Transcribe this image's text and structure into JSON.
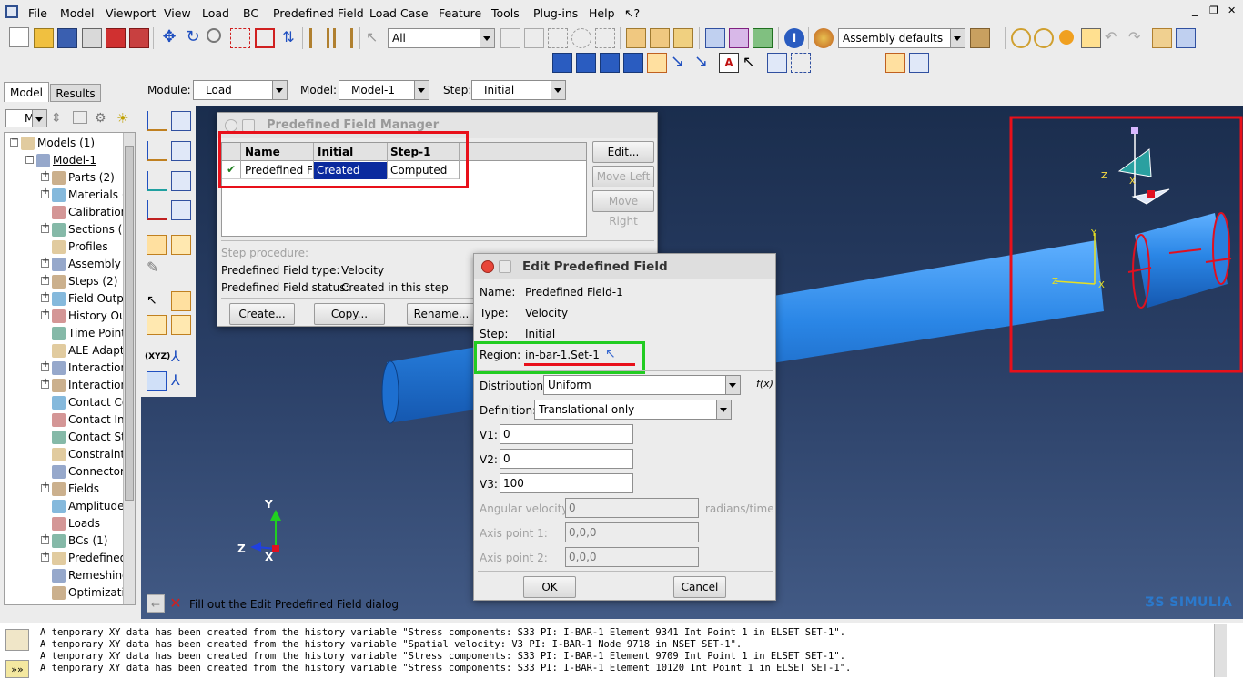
{
  "menu": [
    "File",
    "Model",
    "Viewport",
    "View",
    "Load",
    "BC",
    "Predefined Field",
    "Load Case",
    "Feature",
    "Tools",
    "Plug-ins",
    "Help"
  ],
  "toolbar": {
    "selection_filter": "All",
    "render_style": "Assembly defaults"
  },
  "left_tabs": [
    "Model",
    "Results"
  ],
  "context_bar": {
    "module_label": "Module:",
    "module_value": "Load",
    "model_label": "Model:",
    "model_value": "Model-1",
    "step_label": "Step:",
    "step_value": "Initial"
  },
  "tree": {
    "combo_value": "M",
    "nodes": [
      {
        "label": "Models (1)",
        "indent": 0,
        "expander": "-"
      },
      {
        "label": "Model-1",
        "indent": 1,
        "expander": "-"
      },
      {
        "label": "Parts (2)",
        "indent": 2,
        "expander": "+"
      },
      {
        "label": "Materials (",
        "indent": 2,
        "expander": "+"
      },
      {
        "label": "Calibration",
        "indent": 2,
        "expander": ""
      },
      {
        "label": "Sections (",
        "indent": 2,
        "expander": "+"
      },
      {
        "label": "Profiles",
        "indent": 2,
        "expander": ""
      },
      {
        "label": "Assembly",
        "indent": 2,
        "expander": "+"
      },
      {
        "label": "Steps (2)",
        "indent": 2,
        "expander": "+"
      },
      {
        "label": "Field Outp",
        "indent": 2,
        "expander": "+"
      },
      {
        "label": "History Ou",
        "indent": 2,
        "expander": "+"
      },
      {
        "label": "Time Point",
        "indent": 2,
        "expander": ""
      },
      {
        "label": "ALE Adapt",
        "indent": 2,
        "expander": ""
      },
      {
        "label": "Interaction",
        "indent": 2,
        "expander": "+"
      },
      {
        "label": "Interaction",
        "indent": 2,
        "expander": "+"
      },
      {
        "label": "Contact Co",
        "indent": 2,
        "expander": ""
      },
      {
        "label": "Contact Ini",
        "indent": 2,
        "expander": ""
      },
      {
        "label": "Contact St",
        "indent": 2,
        "expander": ""
      },
      {
        "label": "Constraint",
        "indent": 2,
        "expander": ""
      },
      {
        "label": "Connector",
        "indent": 2,
        "expander": ""
      },
      {
        "label": "Fields",
        "indent": 2,
        "expander": "+"
      },
      {
        "label": "Amplitudes",
        "indent": 2,
        "expander": ""
      },
      {
        "label": "Loads",
        "indent": 2,
        "expander": ""
      },
      {
        "label": "BCs (1)",
        "indent": 2,
        "expander": "+"
      },
      {
        "label": "Predefined",
        "indent": 2,
        "expander": "+"
      },
      {
        "label": "Remeshing",
        "indent": 2,
        "expander": ""
      },
      {
        "label": "Optimizatio",
        "indent": 2,
        "expander": ""
      }
    ]
  },
  "manager": {
    "title": "Predefined Field Manager",
    "columns": [
      "Name",
      "Initial",
      "Step-1"
    ],
    "row": {
      "name": "Predefined Fie",
      "initial": "Created",
      "step1": "Computed"
    },
    "buttons": [
      "Edit...",
      "Move Left",
      "Move Right"
    ],
    "step_procedure": "Step procedure:",
    "type_label": "Predefined Field type:",
    "type_value": "Velocity",
    "status_label": "Predefined Field status:",
    "status_value": "Created in this step",
    "bottom_buttons": [
      "Create...",
      "Copy...",
      "Rename..."
    ]
  },
  "edit": {
    "title": "Edit Predefined Field",
    "name_label": "Name:",
    "name_value": "Predefined Field-1",
    "type_label": "Type:",
    "type_value": "Velocity",
    "step_label": "Step:",
    "step_value": "Initial",
    "region_label": "Region:",
    "region_value": "in-bar-1.Set-1",
    "distribution_label": "Distribution:",
    "distribution_value": "Uniform",
    "fx": "f(x)",
    "definition_label": "Definition:",
    "definition_value": "Translational only",
    "v1_label": "V1:",
    "v1": "0",
    "v2_label": "V2:",
    "v2": "0",
    "v3_label": "V3:",
    "v3": "100",
    "angular_label": "Angular velocity:",
    "angular_value": "0",
    "angular_unit": "radians/time",
    "axis1_label": "Axis point 1:",
    "axis1": "0,0,0",
    "axis2_label": "Axis point 2:",
    "axis2": "0,0,0",
    "ok": "OK",
    "cancel": "Cancel"
  },
  "prompt": "Fill out the Edit Predefined Field dialog",
  "brand": "SIMULIA",
  "messages": [
    "A temporary XY data has been created from the history variable \"Stress components: S33 PI: I-BAR-1 Element 9341 Int Point 1 in ELSET SET-1\".",
    "A temporary XY data has been created from the history variable \"Spatial velocity: V3 PI: I-BAR-1 Node 9718 in NSET SET-1\".",
    "A temporary XY data has been created from the history variable \"Stress components: S33 PI: I-BAR-1 Element 9709 Int Point 1 in ELSET SET-1\".",
    "A temporary XY data has been created from the history variable \"Stress components: S33 PI: I-BAR-1 Element 10120 Int Point 1 in ELSET SET-1\"."
  ],
  "triad": {
    "y": "Y",
    "z": "Z",
    "x": "X"
  },
  "colors": {
    "highlight_red": "#e8101a",
    "highlight_green": "#22cc22",
    "selection_blue": "#0a2a9e",
    "bar_blue": "#2a86e6"
  }
}
